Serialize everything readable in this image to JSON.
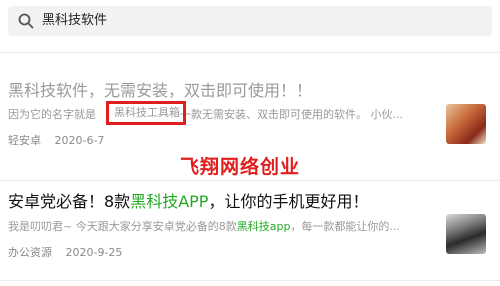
{
  "search": {
    "query": "黑科技软件"
  },
  "results": [
    {
      "title": "黑科技软件，无需安装，双击即可使用！！",
      "snippet_before": "因为它的名字就是",
      "snippet_boxed": "黑科技工具箱",
      "snippet_after": "一款无需安装、双击即可使用的软件。 小伙...",
      "source": "轻安卓",
      "date": "2020-6-7"
    },
    {
      "title_before": "安卓党必备！8款",
      "title_highlight": "黑科技APP",
      "title_after": "，让你的手机更好用！",
      "snippet_before": "我是叨叨君~ 今天跟大家分享安卓党必备的8款",
      "snippet_highlight": "黑科技app",
      "snippet_after": "，每一款都能让你的...",
      "source": "办公资源",
      "date": "2020-9-25"
    }
  ],
  "watermark": "飞翔网络创业",
  "colors": {
    "highlight": "#22aa22",
    "annotation_red": "#e21d1d",
    "watermark": "#e21d1d"
  }
}
